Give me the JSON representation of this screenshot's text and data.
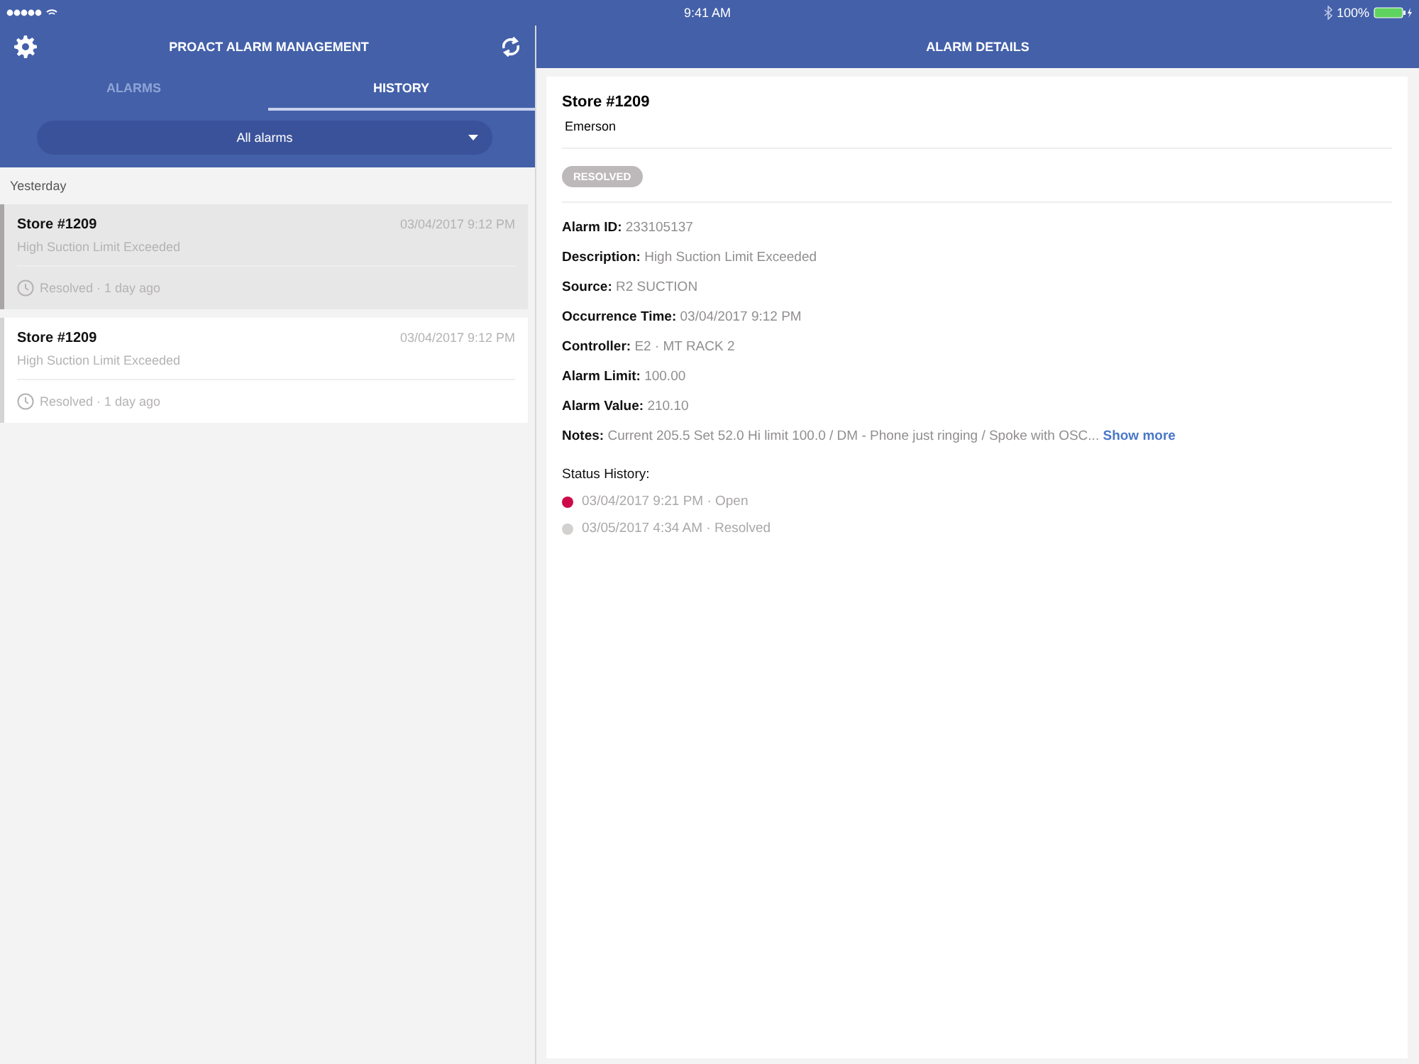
{
  "status_bar": {
    "time": "9:41 AM",
    "battery": "100%"
  },
  "left": {
    "title": "PROACT ALARM MANAGEMENT",
    "tabs": [
      {
        "label": "ALARMS",
        "selected": false
      },
      {
        "label": "HISTORY",
        "selected": true
      }
    ],
    "filter": {
      "value": "All alarms"
    },
    "section": "Yesterday",
    "cards": [
      {
        "store": "Store #1209",
        "time": "03/04/2017 9:12 PM",
        "description": "High Suction Limit Exceeded",
        "status": "Resolved · 1 day ago",
        "selected": true
      },
      {
        "store": "Store #1209",
        "time": "03/04/2017 9:12 PM",
        "description": "High Suction Limit Exceeded",
        "status": "Resolved · 1 day ago",
        "selected": false
      }
    ]
  },
  "detail": {
    "title": "ALARM DETAILS",
    "store": "Store #1209",
    "company": "Emerson",
    "badge": "RESOLVED",
    "fields": [
      {
        "label": "Alarm ID:",
        "value": "233105137"
      },
      {
        "label": "Description:",
        "value": "High Suction Limit Exceeded"
      },
      {
        "label": "Source:",
        "value": "R2 SUCTION"
      },
      {
        "label": "Occurrence Time:",
        "value": "03/04/2017 9:12 PM"
      },
      {
        "label": "Controller:",
        "value": "E2 · MT RACK 2"
      },
      {
        "label": "Alarm Limit:",
        "value": "100.00"
      },
      {
        "label": "Alarm Value:",
        "value": "210.10"
      },
      {
        "label": "Notes:",
        "value": "Current 205.5 Set 52.0 Hi limit 100.0 / DM - Phone just ringing / Spoke with OSC...",
        "link": "Show more"
      }
    ],
    "history_label": "Status History:",
    "history": [
      {
        "text": "03/04/2017 9:21 PM · Open",
        "color": "#cc0a4a"
      },
      {
        "text": "03/05/2017 4:34 AM · Resolved",
        "color": "#d3d0d0"
      }
    ]
  }
}
